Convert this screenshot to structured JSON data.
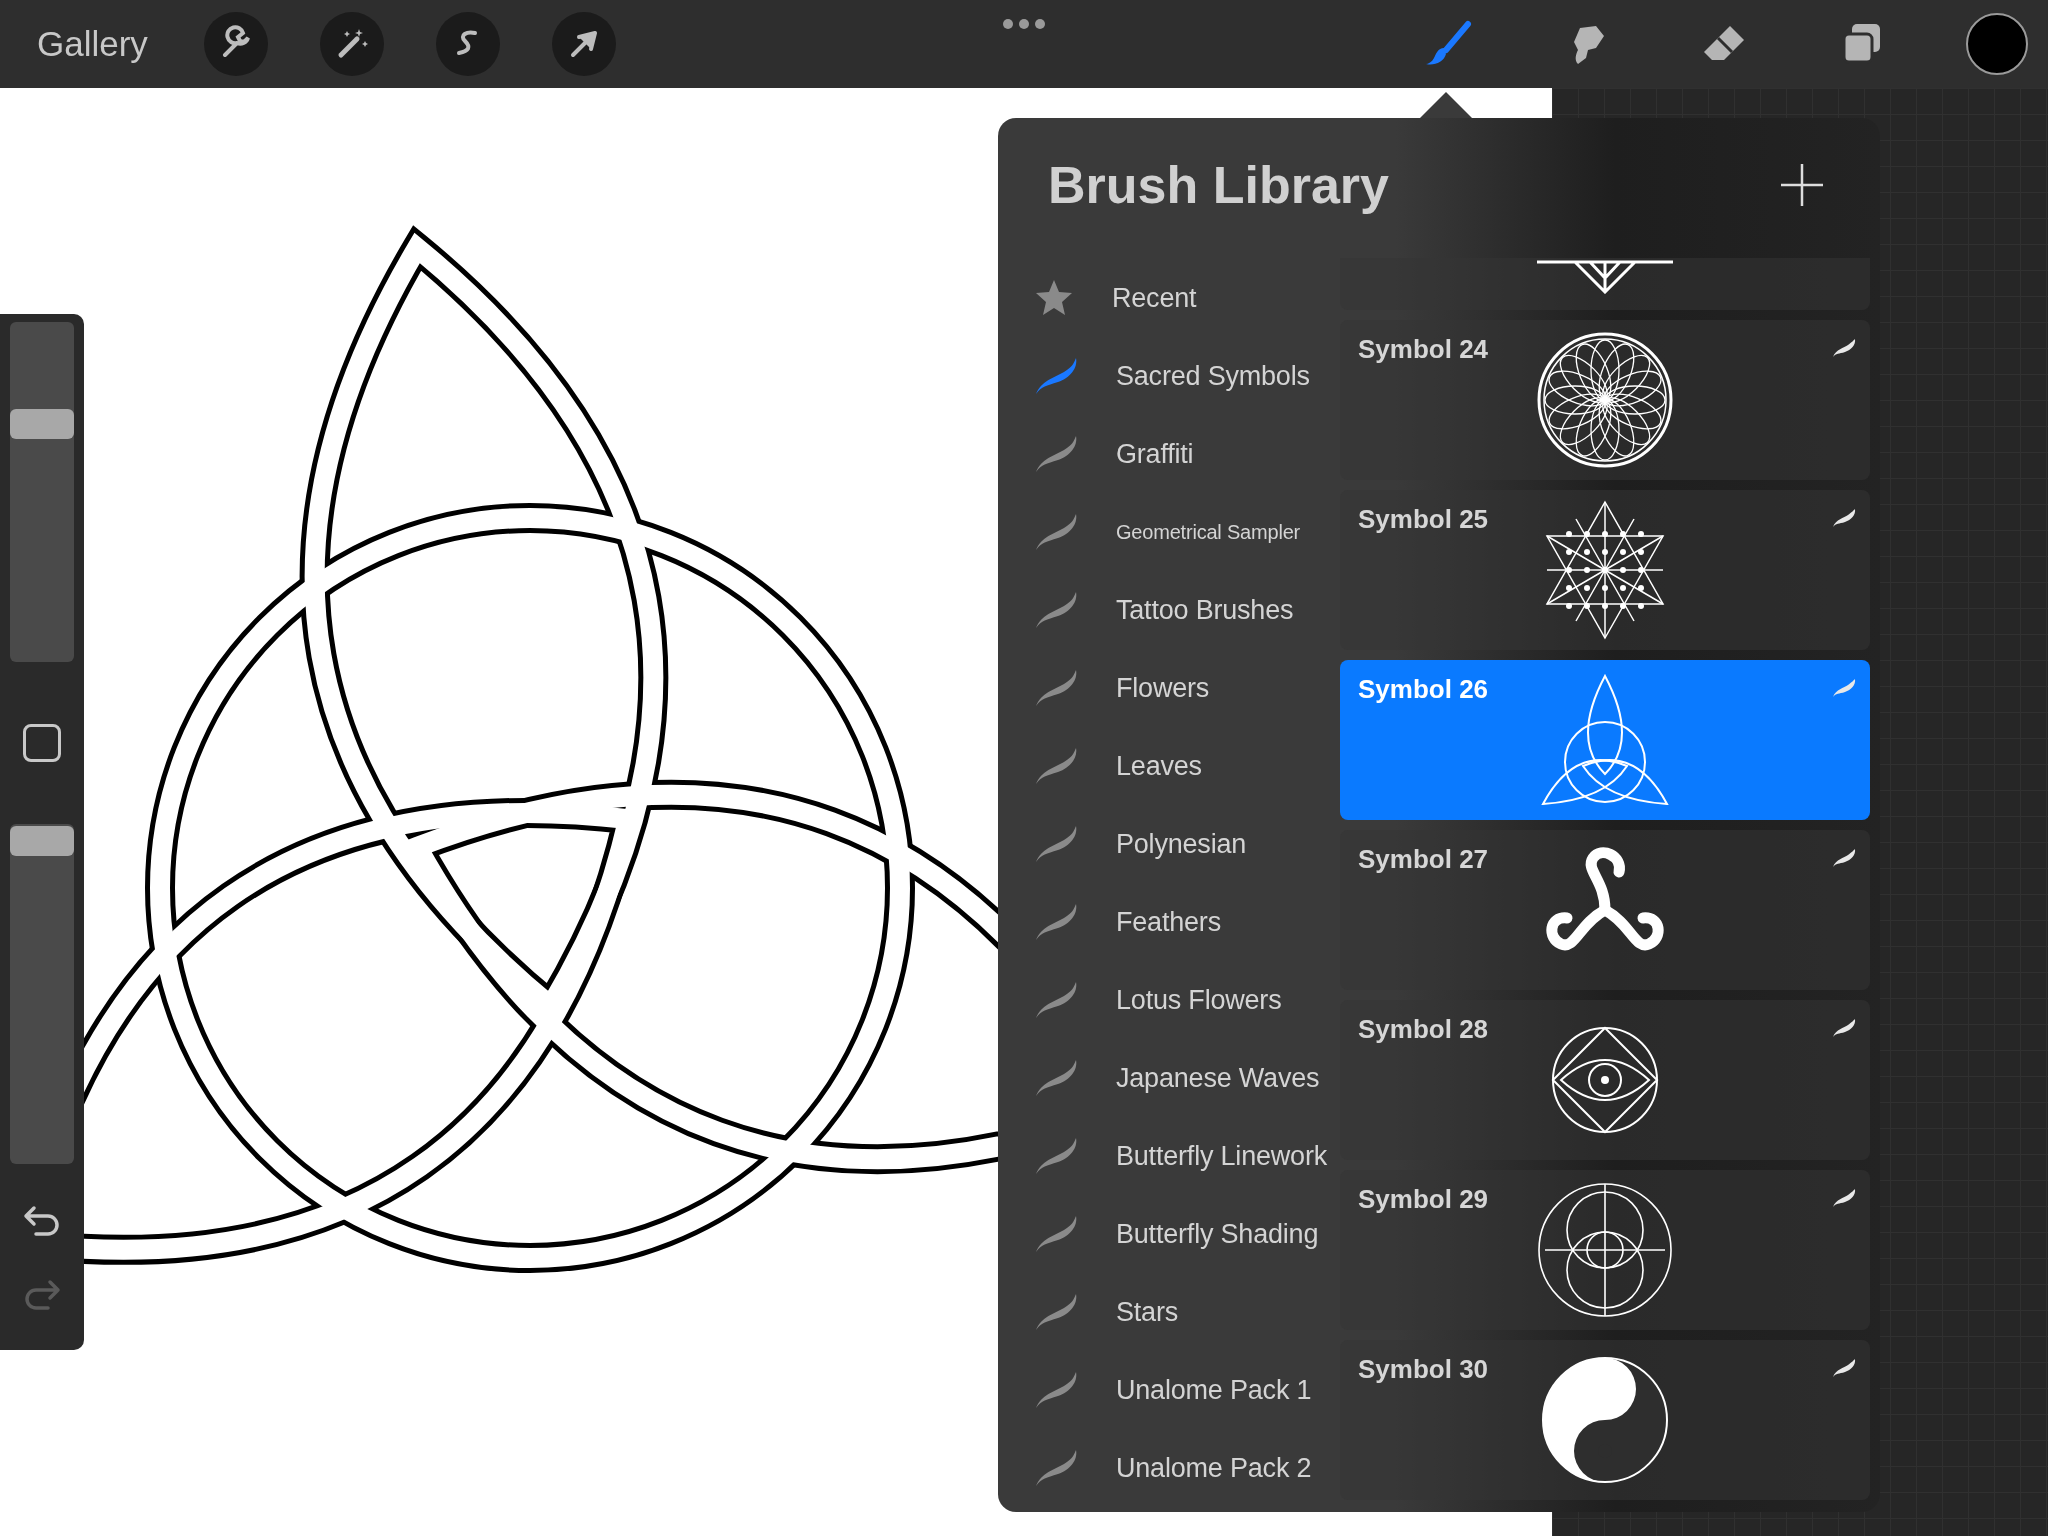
{
  "top_bar": {
    "gallery": "Gallery",
    "actions": [
      {
        "kind": "wrench"
      },
      {
        "kind": "wand"
      },
      {
        "kind": "selection"
      },
      {
        "kind": "arrow"
      }
    ],
    "tools": [
      {
        "kind": "brush",
        "selected": true
      },
      {
        "kind": "smudge",
        "selected": false
      },
      {
        "kind": "eraser",
        "selected": false
      },
      {
        "kind": "layers",
        "selected": false
      }
    ],
    "color": "#000000"
  },
  "side_bar": {
    "size_slider": {
      "level": 0.7
    },
    "opacity_slider": {
      "level": 0.95
    }
  },
  "brush_library": {
    "title": "Brush Library",
    "categories": [
      {
        "label": "Recent",
        "kind": "star",
        "selected": false,
        "small_text": false
      },
      {
        "label": "Sacred Symbols",
        "kind": "stroke",
        "selected": true,
        "small_text": false
      },
      {
        "label": "Graffiti",
        "kind": "stroke",
        "selected": false,
        "small_text": false
      },
      {
        "label": "Geometrical Sampler",
        "kind": "stroke",
        "selected": false,
        "small_text": true
      },
      {
        "label": "Tattoo Brushes",
        "kind": "stroke",
        "selected": false,
        "small_text": false
      },
      {
        "label": "Flowers",
        "kind": "stroke",
        "selected": false,
        "small_text": false
      },
      {
        "label": "Leaves",
        "kind": "stroke",
        "selected": false,
        "small_text": false
      },
      {
        "label": "Polynesian",
        "kind": "stroke",
        "selected": false,
        "small_text": false
      },
      {
        "label": "Feathers",
        "kind": "stroke",
        "selected": false,
        "small_text": false
      },
      {
        "label": "Lotus Flowers",
        "kind": "stroke",
        "selected": false,
        "small_text": false
      },
      {
        "label": "Japanese Waves",
        "kind": "stroke",
        "selected": false,
        "small_text": false
      },
      {
        "label": "Butterfly Linework",
        "kind": "stroke",
        "selected": false,
        "small_text": false
      },
      {
        "label": "Butterfly Shading",
        "kind": "stroke",
        "selected": false,
        "small_text": false
      },
      {
        "label": "Stars",
        "kind": "stroke",
        "selected": false,
        "small_text": false
      },
      {
        "label": "Unalome Pack 1",
        "kind": "stroke",
        "selected": false,
        "small_text": false
      },
      {
        "label": "Unalome Pack 2",
        "kind": "stroke",
        "selected": false,
        "small_text": false
      }
    ],
    "brushes": [
      {
        "name": "Symbol 24",
        "kind": "mandala",
        "selected": false
      },
      {
        "name": "Symbol 25",
        "kind": "star-lattice",
        "selected": false
      },
      {
        "name": "Symbol 26",
        "kind": "triquetra",
        "selected": true
      },
      {
        "name": "Symbol 27",
        "kind": "triskele",
        "selected": false
      },
      {
        "name": "Symbol 28",
        "kind": "eye",
        "selected": false
      },
      {
        "name": "Symbol 29",
        "kind": "vesica",
        "selected": false
      },
      {
        "name": "Symbol 30",
        "kind": "yin-yang",
        "selected": false
      }
    ]
  }
}
